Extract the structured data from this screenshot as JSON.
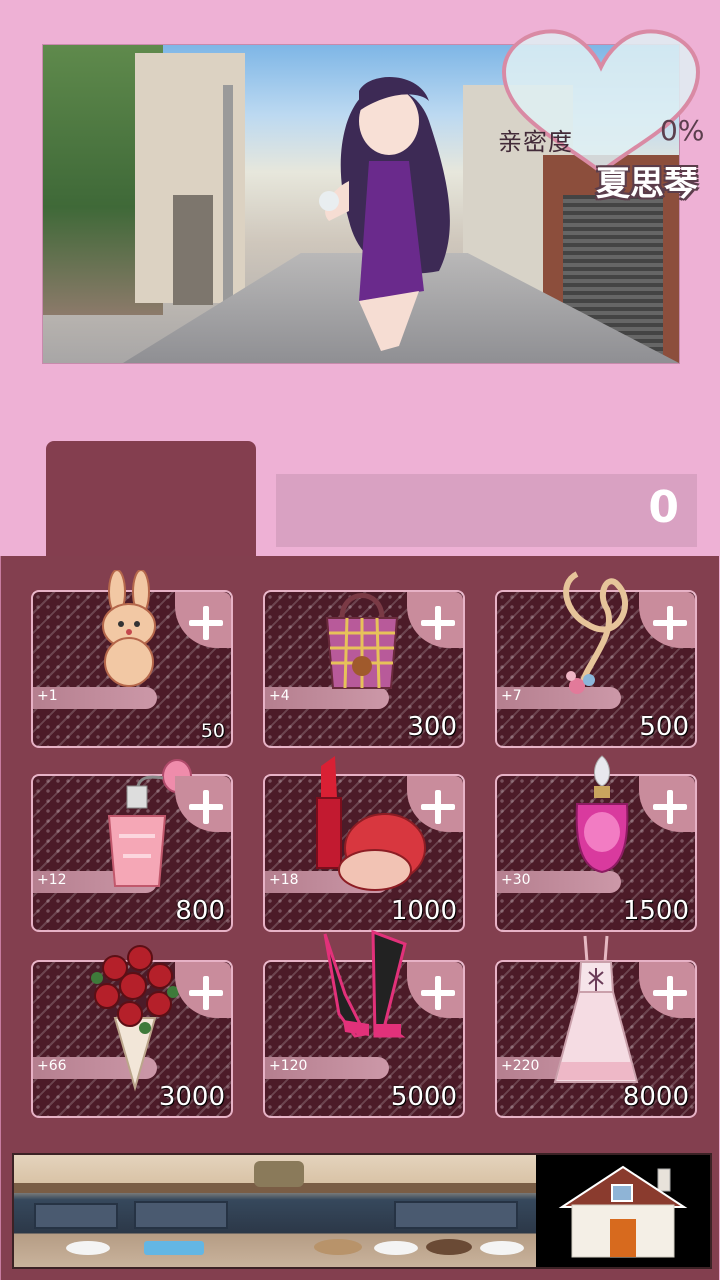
{
  "header": {
    "affinity_label": "亲密度",
    "affinity_value": "0%",
    "character_name": "夏思琴"
  },
  "score": {
    "value": "0"
  },
  "shop": {
    "items": [
      {
        "name": "bunny",
        "bonus": "+1",
        "price": "50"
      },
      {
        "name": "bag",
        "bonus": "+4",
        "price": "300"
      },
      {
        "name": "necklace",
        "bonus": "+7",
        "price": "500"
      },
      {
        "name": "perfume-pink",
        "bonus": "+12",
        "price": "800"
      },
      {
        "name": "lipstick",
        "bonus": "+18",
        "price": "1000"
      },
      {
        "name": "perfume-bottle",
        "bonus": "+30",
        "price": "1500"
      },
      {
        "name": "rose-bouquet",
        "bonus": "+66",
        "price": "3000"
      },
      {
        "name": "heels",
        "bonus": "+120",
        "price": "5000"
      },
      {
        "name": "dress",
        "bonus": "+220",
        "price": "8000"
      }
    ]
  },
  "icons": {
    "plus": "plus-icon",
    "home": "house-icon",
    "heart": "heart-icon"
  }
}
